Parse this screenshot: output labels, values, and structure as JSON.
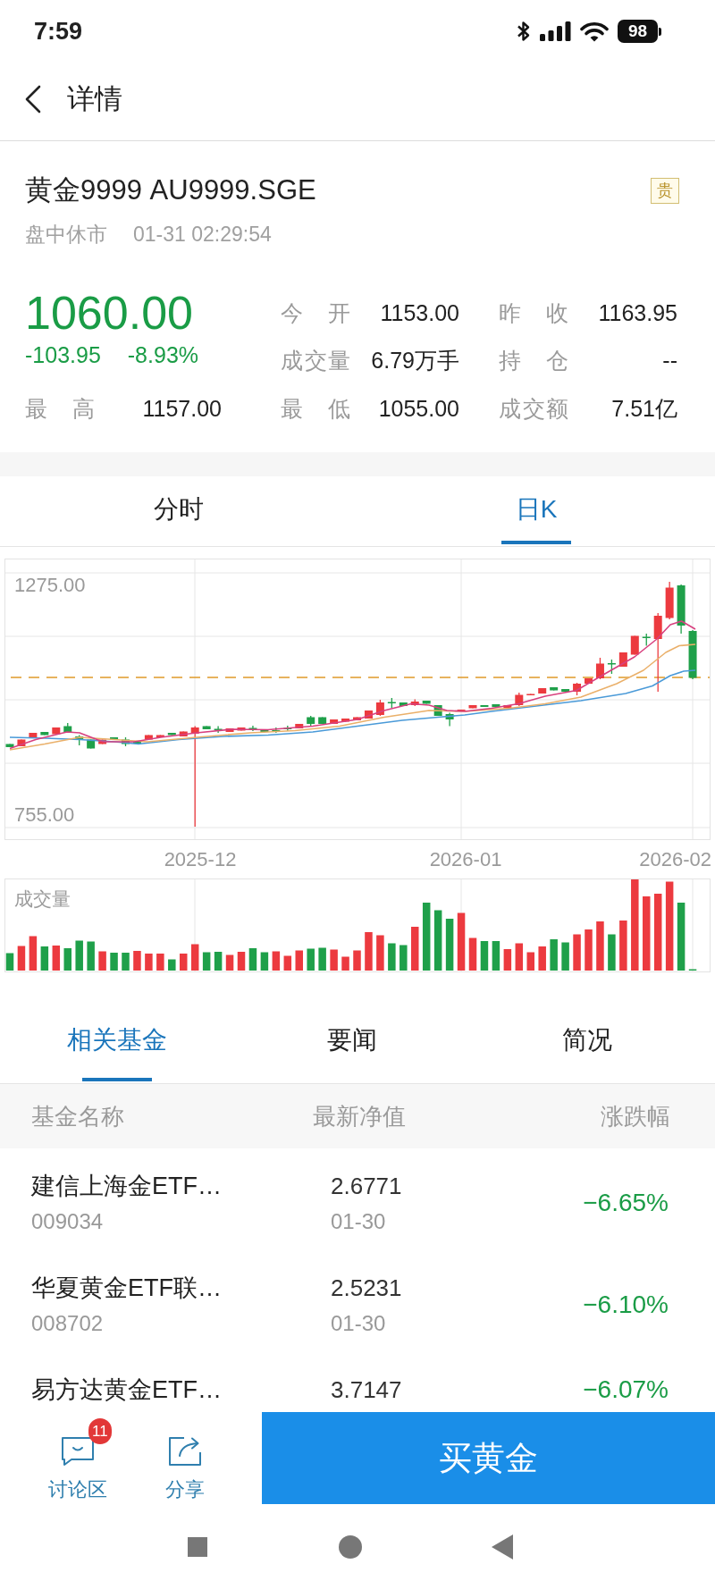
{
  "status_bar": {
    "time": "7:59",
    "battery": "98"
  },
  "header": {
    "title": "详情"
  },
  "quote": {
    "name": "黄金9999 AU9999.SGE",
    "badge": "贵",
    "session": "盘中休市",
    "timestamp": "01-31 02:29:54",
    "price": "1060.00",
    "change": "-103.95",
    "change_percent": "-8.93%",
    "down": true,
    "high": {
      "label": "最 高",
      "value": "1157.00"
    },
    "stats": [
      {
        "label": "今 开",
        "value": "1153.00"
      },
      {
        "label": "昨 收",
        "value": "1163.95"
      },
      {
        "label": "成交量",
        "value": "6.79万手"
      },
      {
        "label": "持 仓",
        "value": "--"
      },
      {
        "label": "最 低",
        "value": "1055.00"
      },
      {
        "label": "成交额",
        "value": "7.51亿"
      }
    ]
  },
  "chart_tabs": [
    {
      "label": "分时",
      "selected": false
    },
    {
      "label": "日K",
      "selected": true
    }
  ],
  "kline_chart": {
    "y_labels": [
      "1275.00",
      "755.00"
    ],
    "x_labels": [
      "2025-12",
      "2026-01",
      "2026-02"
    ],
    "volume_title": "成交量"
  },
  "info_tabs": [
    {
      "label": "相关基金",
      "selected": true
    },
    {
      "label": "要闻",
      "selected": false
    },
    {
      "label": "简况",
      "selected": false
    }
  ],
  "funds": {
    "columns": [
      "基金名称",
      "最新净值",
      "涨跌幅"
    ],
    "rows": [
      {
        "name": "建信上海金ETF…",
        "code": "009034",
        "nav": "2.6771",
        "date": "01-30",
        "change": "−6.65%",
        "down": true
      },
      {
        "name": "华夏黄金ETF联…",
        "code": "008702",
        "nav": "2.5231",
        "date": "01-30",
        "change": "−6.10%",
        "down": true
      },
      {
        "name": "易方达黄金ETF…",
        "nav": "3.7147",
        "change": "−6.07%",
        "down": true
      }
    ]
  },
  "bottom_bar": {
    "actions": [
      {
        "kind": "chat",
        "label": "讨论区",
        "badge": "11"
      },
      {
        "kind": "share",
        "label": "分享"
      }
    ],
    "primary_button": "买黄金"
  }
}
